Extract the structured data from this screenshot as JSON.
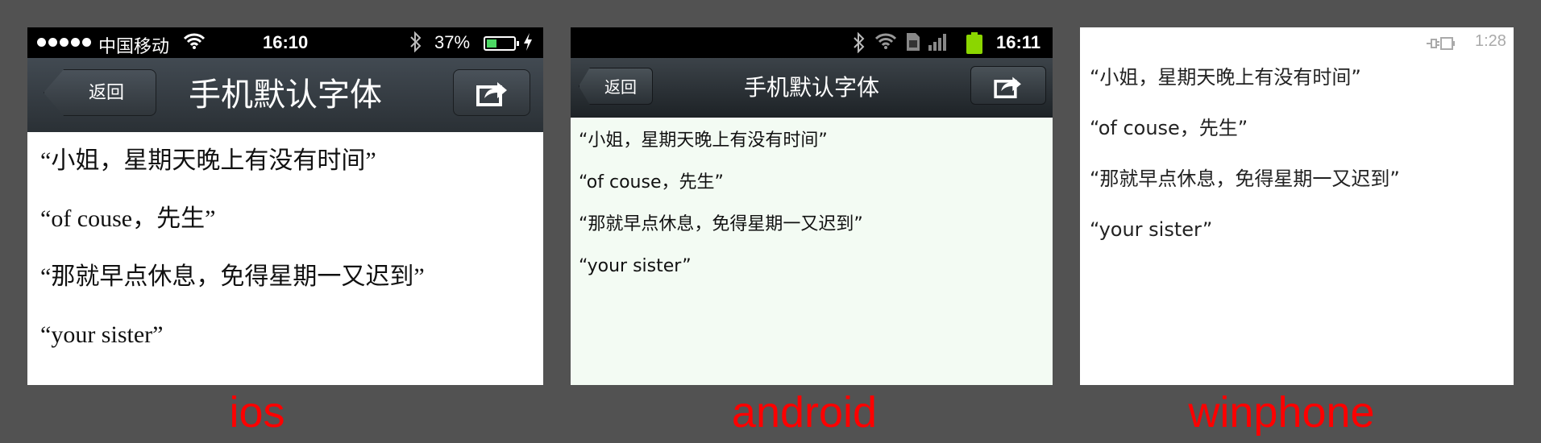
{
  "ios": {
    "status": {
      "carrier": "中国移动",
      "time": "16:10",
      "battery": "37%",
      "battery_level": 0.37
    },
    "nav": {
      "back": "返回",
      "title": "手机默认字体"
    },
    "lines": [
      "“小姐，星期天晚上有没有时间”",
      "“of couse，先生”",
      "“那就早点休息，免得星期一又迟到”",
      "“your sister”"
    ],
    "label": "ios"
  },
  "android": {
    "status": {
      "time": "16:11"
    },
    "nav": {
      "back": "返回",
      "title": "手机默认字体"
    },
    "lines": [
      "“小姐，星期天晚上有没有时间”",
      "“of couse，先生”",
      "“那就早点休息，免得星期一又迟到”",
      "“your sister”"
    ],
    "label": "android"
  },
  "winphone": {
    "status": {
      "time": "1:28"
    },
    "lines": [
      "“小姐，星期天晚上有没有时间”",
      "“of couse，先生”",
      "“那就早点休息，免得星期一又迟到”",
      "“your sister”"
    ],
    "label": "winphone"
  },
  "colors": {
    "label": "#ff0000",
    "backdrop": "#525252",
    "android_bg": "#f3fbf3"
  },
  "icons": [
    "signal-dots-icon",
    "wifi-icon",
    "bluetooth-icon",
    "battery-icon",
    "charging-icon",
    "share-icon",
    "sim-icon",
    "cell-signal-icon",
    "plug-battery-icon"
  ]
}
